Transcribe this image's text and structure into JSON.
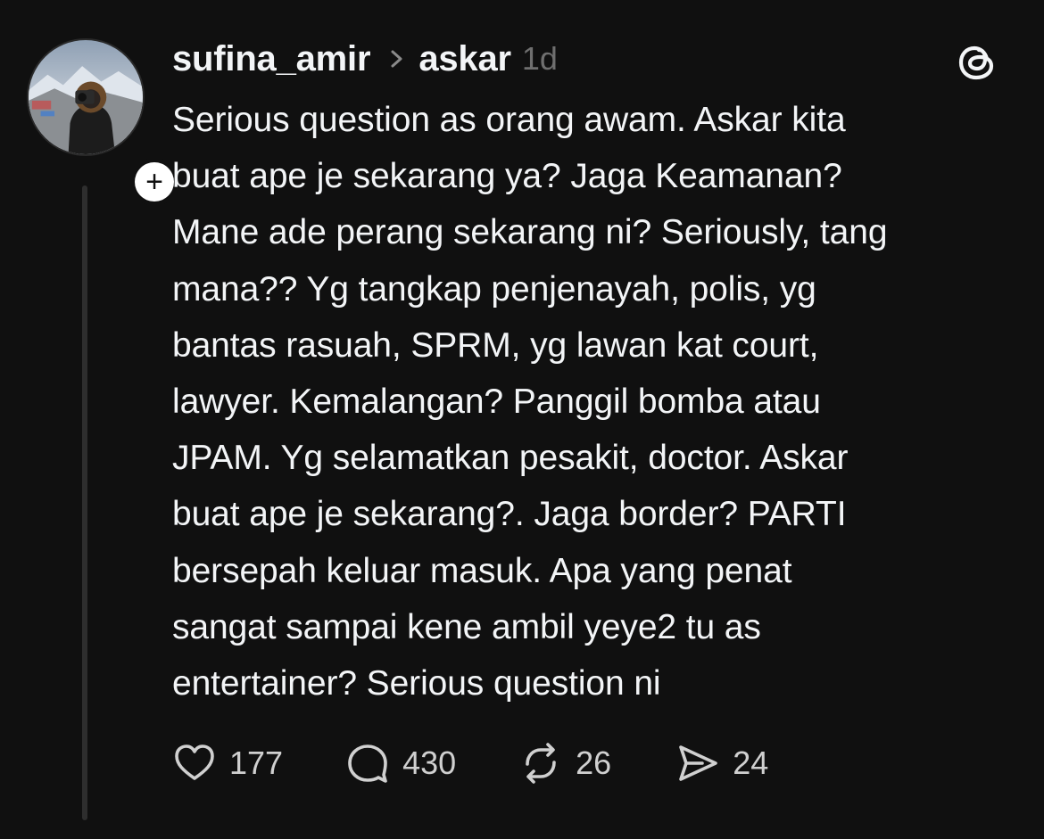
{
  "post": {
    "author": "sufina_amir",
    "reply_to": "askar",
    "timestamp": "1d",
    "follow_symbol": "+",
    "text_lines": [
      "Serious question as orang awam.  Askar kita",
      "buat ape je sekarang ya? Jaga Keamanan?",
      "Mane ade perang sekarang ni? Seriously, tang",
      "mana?? Yg tangkap penjenayah, polis, yg",
      "bantas rasuah, SPRM, yg lawan kat court,",
      "lawyer. Kemalangan? Panggil bomba atau",
      "JPAM. Yg selamatkan pesakit, doctor. Askar",
      "buat ape je sekarang?. Jaga border? PARTI",
      "bersepah keluar masuk. Apa yang penat",
      "sangat sampai kene ambil yeye2 tu as",
      "entertainer? Serious question ni"
    ]
  },
  "actions": {
    "likes": "177",
    "replies": "430",
    "reposts": "26",
    "shares": "24"
  },
  "icons": {
    "like": "heart-icon",
    "reply": "speech-bubble-icon",
    "repost": "repost-icon",
    "share": "send-icon",
    "brand": "threads-logo-icon",
    "separator": "chevron-right-icon"
  },
  "colors": {
    "background": "#101010",
    "text": "#f3f5f7",
    "muted": "#6f6f6f",
    "thread_line": "#2e2e2e"
  }
}
